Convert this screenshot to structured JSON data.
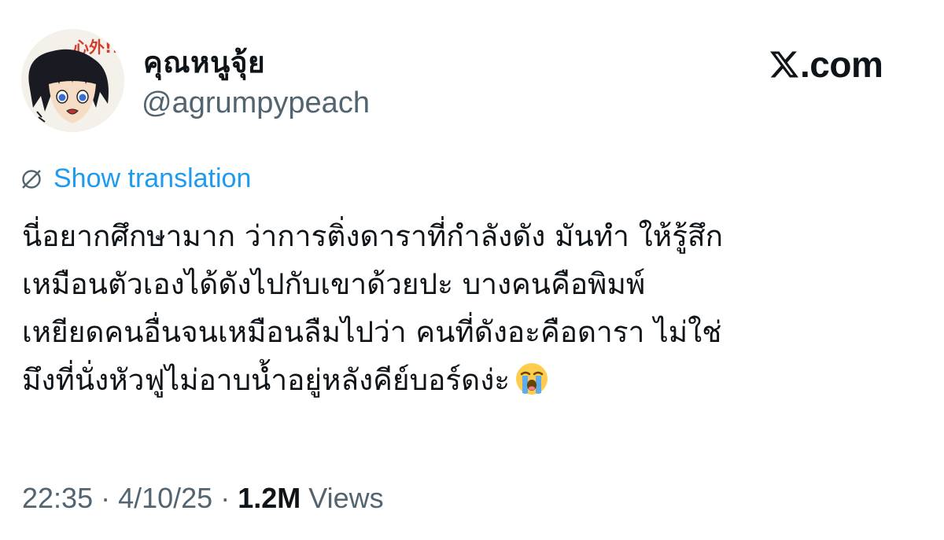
{
  "author": {
    "display_name": "คุณหนูจุ้ย",
    "handle": "@agrumpypeach",
    "avatar": "anime-character-avatar"
  },
  "brand": {
    "logo_text": ".com",
    "logo_icon": "x-logo-icon"
  },
  "translate": {
    "label": "Show translation",
    "icon": "globe-slash-icon",
    "color": "#1d9bf0"
  },
  "tweet": {
    "lines": [
      "นี่อยากศึกษามาก ว่าการติ่งดาราที่กำลังดัง มันทำ ให้รู้สึก",
      "เหมือนตัวเองได้ดังไปกับเขาด้วยปะ บางคนคือพิมพ์",
      "เหยียดคนอื่นจนเหมือนลืมไปว่า คนที่ดังอะคือดารา ไม่ใช่",
      "มึงที่นั่งหัวฟูไม่อาบน้ำอยู่หลังคีย์บอร์ดง่ะ"
    ],
    "emoji": "loudly-crying-face-emoji"
  },
  "meta": {
    "time": "22:35",
    "sep1": " · ",
    "date": "4/10/25",
    "sep2": " · ",
    "views_count": "1.2M",
    "views_label": " Views"
  },
  "colors": {
    "text": "#0f1419",
    "secondary": "#536471",
    "accent": "#1d9bf0"
  }
}
